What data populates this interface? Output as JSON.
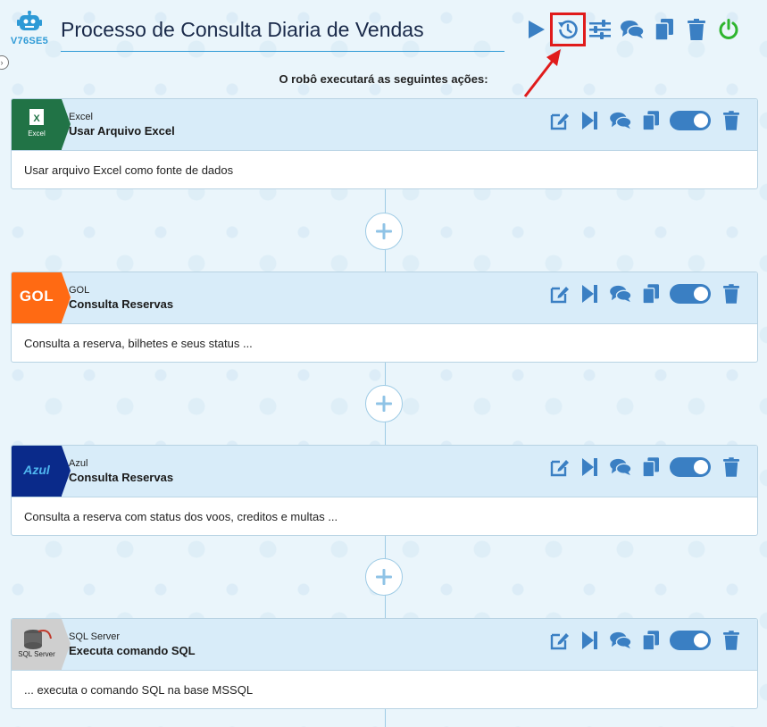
{
  "robot": {
    "code": "V76SE5"
  },
  "header": {
    "title": "Processo de Consulta Diaria de Vendas"
  },
  "toolbar": {
    "icons": [
      "play-icon",
      "history-icon",
      "settings-sliders-icon",
      "comments-icon",
      "copy-icon",
      "trash-icon",
      "power-icon"
    ]
  },
  "subtitle": "O robô executará as seguintes ações:",
  "colors": {
    "accent": "#2e9ad6",
    "icon": "#3a7fc3",
    "power": "#2fb52f",
    "highlight": "#e01b1b"
  },
  "steps": [
    {
      "category": "Excel",
      "name": "Usar Arquivo Excel",
      "description": "Usar arquivo Excel como fonte de dados",
      "logo_text": "Excel",
      "logo_color": "#217346"
    },
    {
      "category": "GOL",
      "name": "Consulta Reservas",
      "description": "Consulta a reserva, bilhetes e seus status ...",
      "logo_text": "GOL",
      "logo_color": "#ff6a13"
    },
    {
      "category": "Azul",
      "name": "Consulta Reservas",
      "description": "Consulta a reserva com status dos voos, creditos e multas ...",
      "logo_text": "Azul",
      "logo_color": "#0a2a8a"
    },
    {
      "category": "SQL Server",
      "name": "Executa comando SQL",
      "description": "... executa o comando SQL na base MSSQL",
      "logo_text": "SQL Server",
      "logo_color": "#cfcfcf"
    }
  ]
}
